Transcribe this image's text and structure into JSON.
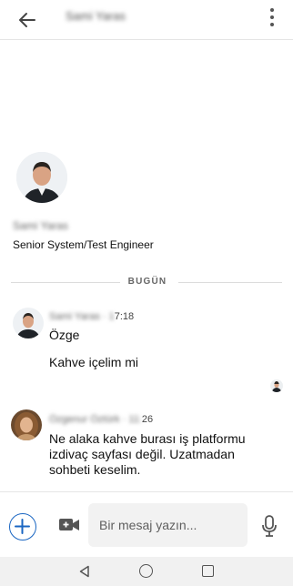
{
  "header": {
    "title": "Sami Yaras",
    "back_icon": "arrow-left-icon",
    "more_icon": "more-vertical-icon"
  },
  "profile": {
    "name": "Sami Yaras",
    "headline": "Senior System/Test Engineer"
  },
  "day_divider": "BUGÜN",
  "messages": [
    {
      "sender": "Sami Yaras",
      "time_visible": "7:18",
      "lines": [
        "Özge",
        "Kahve içelim mi"
      ]
    },
    {
      "sender": "Özgenur Öztürk",
      "time_visible": "26",
      "text": "Ne alaka kahve burası iş platformu izdivaç sayfası değil. Uzatmadan sohbeti keselim."
    }
  ],
  "composer": {
    "placeholder": "Bir mesaj yazın...",
    "add_icon": "plus-icon",
    "video_icon": "video-plus-icon",
    "mic_icon": "microphone-icon"
  },
  "system_nav": {
    "back_icon": "triangle-back-icon",
    "home_icon": "circle-home-icon",
    "recents_icon": "square-recents-icon"
  },
  "colors": {
    "accent": "#1a66c2",
    "input_bg": "#f2f2f2",
    "nav_bg": "#f1f1f1"
  }
}
